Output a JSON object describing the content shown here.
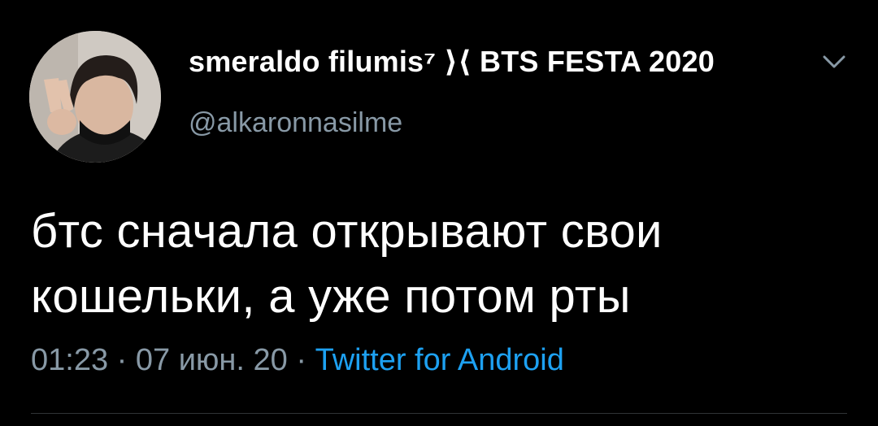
{
  "tweet": {
    "author": {
      "display_name": "smeraldo filumis⁷ ⟩⟨ BTS FESTA 2020",
      "handle": "@alkaronnasilme",
      "avatar_icon": "profile-photo"
    },
    "text": "бтс сначала открывают свои\nкошельки, а уже потом рты",
    "time": "01:23",
    "date": "07 июн. 20",
    "separator": " · ",
    "source": "Twitter for Android",
    "menu_icon": "chevron-down-icon"
  },
  "colors": {
    "background": "#000000",
    "text_primary": "#ffffff",
    "text_secondary": "#8899a6",
    "link": "#1da1f2",
    "divider": "#2f3336"
  }
}
